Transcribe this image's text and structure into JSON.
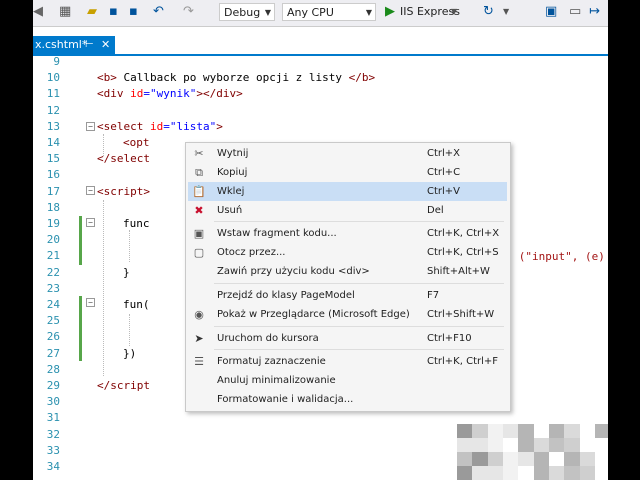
{
  "toolbar": {
    "config": "Debug",
    "platform": "Any CPU",
    "run": "IIS Express"
  },
  "tab": {
    "name": "x.cshtml*",
    "pin": "⊢",
    "close": "✕"
  },
  "editor": {
    "lines": [
      {
        "n": "9",
        "parts": []
      },
      {
        "n": "10",
        "parts": [
          [
            "t",
            "<b>"
          ],
          [
            "txt",
            " Callback po wyborze opcji z listy "
          ],
          [
            "t",
            "</b>"
          ]
        ]
      },
      {
        "n": "11",
        "parts": [
          [
            "t",
            "<div"
          ],
          [
            "txt",
            " "
          ],
          [
            "a",
            "id"
          ],
          [
            "s",
            "=\"wynik\""
          ],
          [
            "t",
            "></div>"
          ]
        ]
      },
      {
        "n": "12",
        "parts": []
      },
      {
        "n": "13",
        "parts": [
          [
            "t",
            "<select"
          ],
          [
            "txt",
            " "
          ],
          [
            "a",
            "id"
          ],
          [
            "s",
            "=\"lista\""
          ],
          [
            "t",
            ">"
          ]
        ]
      },
      {
        "n": "14",
        "parts": [
          [
            "t",
            "<opt"
          ]
        ]
      },
      {
        "n": "15",
        "parts": [
          [
            "t",
            "</select"
          ]
        ]
      },
      {
        "n": "16",
        "parts": []
      },
      {
        "n": "17",
        "parts": [
          [
            "t",
            "<script"
          ],
          [
            "t",
            ">"
          ]
        ]
      },
      {
        "n": "18",
        "parts": []
      },
      {
        "n": "19",
        "parts": [
          [
            "txt",
            "func"
          ]
        ]
      },
      {
        "n": "20",
        "parts": []
      },
      {
        "n": "21",
        "parts": []
      },
      {
        "n": "22",
        "parts": [
          [
            "txt",
            "}"
          ]
        ]
      },
      {
        "n": "23",
        "parts": []
      },
      {
        "n": "24",
        "parts": [
          [
            "txt",
            "fun("
          ]
        ]
      },
      {
        "n": "25",
        "parts": []
      },
      {
        "n": "26",
        "parts": []
      },
      {
        "n": "27",
        "parts": [
          [
            "txt",
            "})"
          ]
        ]
      },
      {
        "n": "28",
        "parts": []
      },
      {
        "n": "29",
        "parts": [
          [
            "t",
            "</script"
          ]
        ]
      },
      {
        "n": "30",
        "parts": []
      },
      {
        "n": "31",
        "parts": []
      },
      {
        "n": "32",
        "parts": []
      },
      {
        "n": "33",
        "parts": []
      },
      {
        "n": "34",
        "parts": []
      }
    ],
    "line20_tail": "(\"input\", (e) =>"
  },
  "context_menu": {
    "items": [
      {
        "label": "Wytnij",
        "shortcut": "Ctrl+X",
        "icon": "scissors-icon",
        "glyph": "✂"
      },
      {
        "label": "Kopiuj",
        "shortcut": "Ctrl+C",
        "icon": "copy-icon",
        "glyph": "⧉"
      },
      {
        "label": "Wklej",
        "shortcut": "Ctrl+V",
        "icon": "paste-icon",
        "glyph": "📋",
        "highlight": true
      },
      {
        "label": "Usuń",
        "shortcut": "Del",
        "icon": "delete-icon",
        "glyph": "✖"
      },
      {
        "label": "Wstaw fragment kodu...",
        "shortcut": "Ctrl+K, Ctrl+X",
        "icon": "snippet-icon",
        "glyph": "▣"
      },
      {
        "label": "Otocz przez...",
        "shortcut": "Ctrl+K, Ctrl+S",
        "icon": "surround-icon",
        "glyph": "▢"
      },
      {
        "label": "Zawiń przy użyciu kodu <div>",
        "shortcut": "Shift+Alt+W",
        "icon": "",
        "glyph": ""
      },
      {
        "label": "Przejdź do klasy PageModel",
        "shortcut": "F7",
        "icon": "",
        "glyph": ""
      },
      {
        "label": "Pokaż w Przeglądarce (Microsoft Edge)",
        "shortcut": "Ctrl+Shift+W",
        "icon": "browser-icon",
        "glyph": "◉"
      },
      {
        "label": "Uruchom do kursora",
        "shortcut": "Ctrl+F10",
        "icon": "run-to-cursor-icon",
        "glyph": "➤"
      },
      {
        "label": "Formatuj zaznaczenie",
        "shortcut": "Ctrl+K, Ctrl+F",
        "icon": "format-icon",
        "glyph": "☰"
      },
      {
        "label": "Anuluj minimalizowanie",
        "shortcut": "",
        "icon": "",
        "glyph": ""
      },
      {
        "label": "Formatowanie i walidacja...",
        "shortcut": "",
        "icon": "",
        "glyph": ""
      }
    ]
  },
  "colors": {
    "accent": "#007acc",
    "tag": "#800000",
    "attr": "#ff0000",
    "string": "#0000ff",
    "line_number": "#2b91af",
    "menu_highlight": "#c9def5"
  }
}
